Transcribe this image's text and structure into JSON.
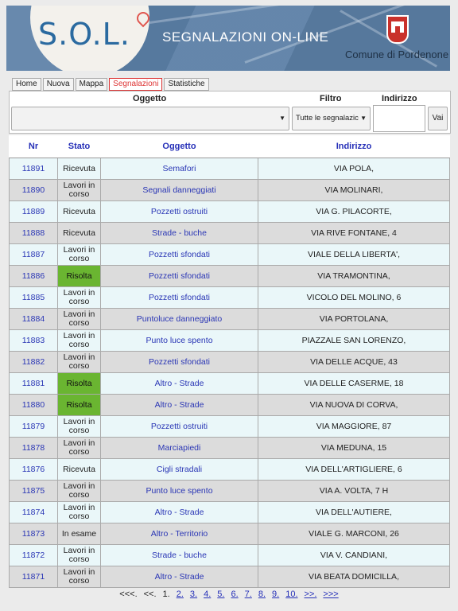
{
  "header": {
    "logo": "S.O.L.",
    "slogan": "SEGNALAZIONI ON-LINE",
    "comune": "Comune di Pordenone"
  },
  "tabs": [
    "Home",
    "Nuova",
    "Mappa",
    "Segnalazioni",
    "Statistiche"
  ],
  "active_tab": "Segnalazioni",
  "filters": {
    "oggetto_label": "Oggetto",
    "oggetto_value": "",
    "filtro_label": "Filtro",
    "filtro_value": "Tutte le segnalazic",
    "indirizzo_label": "Indirizzo",
    "indirizzo_value": "",
    "go_button": "Vai"
  },
  "table": {
    "headers": [
      "Nr",
      "Stato",
      "Oggetto",
      "Indirizzo"
    ],
    "rows": [
      {
        "nr": "11891",
        "stato": "Ricevuta",
        "oggetto": "Semafori",
        "indirizzo": "VIA POLA,"
      },
      {
        "nr": "11890",
        "stato": "Lavori in corso",
        "oggetto": "Segnali danneggiati",
        "indirizzo": "VIA MOLINARI,"
      },
      {
        "nr": "11889",
        "stato": "Ricevuta",
        "oggetto": "Pozzetti ostruiti",
        "indirizzo": "VIA G. PILACORTE,"
      },
      {
        "nr": "11888",
        "stato": "Ricevuta",
        "oggetto": "Strade - buche",
        "indirizzo": "VIA RIVE FONTANE, 4"
      },
      {
        "nr": "11887",
        "stato": "Lavori in corso",
        "oggetto": "Pozzetti sfondati",
        "indirizzo": "VIALE DELLA LIBERTA',"
      },
      {
        "nr": "11886",
        "stato": "Risolta",
        "oggetto": "Pozzetti sfondati",
        "indirizzo": "VIA TRAMONTINA,"
      },
      {
        "nr": "11885",
        "stato": "Lavori in corso",
        "oggetto": "Pozzetti sfondati",
        "indirizzo": "VICOLO DEL MOLINO, 6"
      },
      {
        "nr": "11884",
        "stato": "Lavori in corso",
        "oggetto": "Puntoluce danneggiato",
        "indirizzo": "VIA PORTOLANA,"
      },
      {
        "nr": "11883",
        "stato": "Lavori in corso",
        "oggetto": "Punto luce spento",
        "indirizzo": "PIAZZALE SAN LORENZO,"
      },
      {
        "nr": "11882",
        "stato": "Lavori in corso",
        "oggetto": "Pozzetti sfondati",
        "indirizzo": "VIA DELLE ACQUE, 43"
      },
      {
        "nr": "11881",
        "stato": "Risolta",
        "oggetto": "Altro - Strade",
        "indirizzo": "VIA DELLE CASERME, 18"
      },
      {
        "nr": "11880",
        "stato": "Risolta",
        "oggetto": "Altro - Strade",
        "indirizzo": "VIA NUOVA DI CORVA,"
      },
      {
        "nr": "11879",
        "stato": "Lavori in corso",
        "oggetto": "Pozzetti ostruiti",
        "indirizzo": "VIA MAGGIORE, 87"
      },
      {
        "nr": "11878",
        "stato": "Lavori in corso",
        "oggetto": "Marciapiedi",
        "indirizzo": "VIA MEDUNA, 15"
      },
      {
        "nr": "11876",
        "stato": "Ricevuta",
        "oggetto": "Cigli stradali",
        "indirizzo": "VIA DELL'ARTIGLIERE, 6"
      },
      {
        "nr": "11875",
        "stato": "Lavori in corso",
        "oggetto": "Punto luce spento",
        "indirizzo": "VIA A. VOLTA, 7 H"
      },
      {
        "nr": "11874",
        "stato": "Lavori in corso",
        "oggetto": "Altro - Strade",
        "indirizzo": "VIA DELL'AUTIERE,"
      },
      {
        "nr": "11873",
        "stato": "In esame",
        "oggetto": "Altro - Territorio",
        "indirizzo": "VIALE G. MARCONI, 26"
      },
      {
        "nr": "11872",
        "stato": "Lavori in corso",
        "oggetto": "Strade - buche",
        "indirizzo": "VIA V. CANDIANI,"
      },
      {
        "nr": "11871",
        "stato": "Lavori in corso",
        "oggetto": "Altro - Strade",
        "indirizzo": "VIA BEATA DOMICILLA,"
      }
    ]
  },
  "pagination": [
    {
      "label": "<<<.",
      "link": false
    },
    {
      "label": "<<.",
      "link": false
    },
    {
      "label": "1.",
      "link": false
    },
    {
      "label": "2.",
      "link": true
    },
    {
      "label": "3.",
      "link": true
    },
    {
      "label": "4.",
      "link": true
    },
    {
      "label": "5.",
      "link": true
    },
    {
      "label": "6.",
      "link": true
    },
    {
      "label": "7.",
      "link": true
    },
    {
      "label": "8.",
      "link": true
    },
    {
      "label": "9.",
      "link": true
    },
    {
      "label": "10.",
      "link": true
    },
    {
      "label": ">>.",
      "link": true
    },
    {
      "label": ">>>",
      "link": true
    }
  ],
  "colors": {
    "risolta": "#6ab531",
    "link_blue": "#2630b8",
    "active_tab": "#dd3333"
  }
}
